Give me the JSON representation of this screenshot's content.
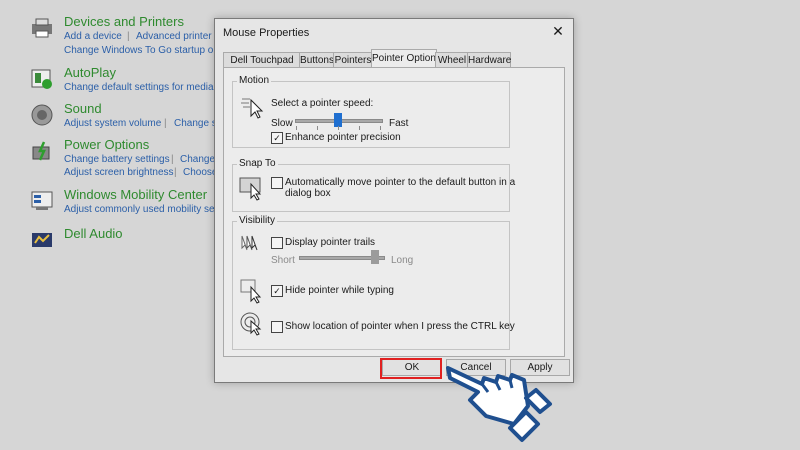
{
  "control_panel": {
    "items": [
      {
        "title": "Devices and Printers",
        "links": [
          "Add a device",
          "Advanced printer se",
          "Change Windows To Go startup optio"
        ]
      },
      {
        "title": "AutoPlay",
        "links": [
          "Change default settings for media or d"
        ]
      },
      {
        "title": "Sound",
        "links": [
          "Adjust system volume",
          "Change sy"
        ]
      },
      {
        "title": "Power Options",
        "links": [
          "Change battery settings",
          "Change p",
          "Adjust screen brightness",
          "Choose"
        ]
      },
      {
        "title": "Windows Mobility Center",
        "links": [
          "Adjust commonly used mobility sett"
        ]
      },
      {
        "title": "Dell Audio",
        "links": []
      }
    ],
    "separator": "|"
  },
  "dialog": {
    "title": "Mouse Properties",
    "close_glyph": "✕",
    "tabs": [
      "Dell Touchpad",
      "Buttons",
      "Pointers",
      "Pointer Options",
      "Wheel",
      "Hardware"
    ],
    "active_tab": "Pointer Options",
    "motion": {
      "label": "Motion",
      "speed_label": "Select a pointer speed:",
      "slow": "Slow",
      "fast": "Fast",
      "speed_value": 0.5,
      "enhance_label": "Enhance pointer precision",
      "enhance_checked": true
    },
    "snap_to": {
      "label": "Snap To",
      "option_line1": "Automatically move pointer to the default button in a",
      "option_line2": "dialog box",
      "checked": false
    },
    "visibility": {
      "label": "Visibility",
      "trails_label": "Display pointer trails",
      "trails_checked": false,
      "short": "Short",
      "long": "Long",
      "trails_value": 0.9,
      "hide_label": "Hide pointer while typing",
      "hide_checked": true,
      "ctrl_label": "Show location of pointer when I press the CTRL key",
      "ctrl_checked": false
    },
    "buttons": {
      "ok": "OK",
      "cancel": "Cancel",
      "apply": "Apply"
    },
    "check_glyph": "✓"
  },
  "colors": {
    "highlight": "#e02020",
    "hand": "#1f4f8f",
    "title_green": "#2f8a2f",
    "link_blue": "#2b5fa8"
  }
}
